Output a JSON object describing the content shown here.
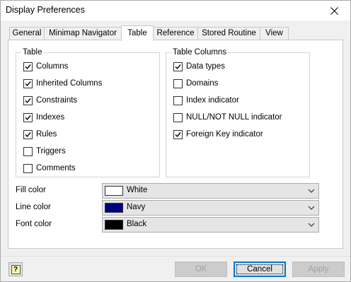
{
  "window": {
    "title": "Display Preferences"
  },
  "tabs": [
    {
      "label": "General",
      "active": false
    },
    {
      "label": "Minimap Navigator",
      "active": false
    },
    {
      "label": "Table",
      "active": true
    },
    {
      "label": "Reference",
      "active": false
    },
    {
      "label": "Stored Routine",
      "active": false
    },
    {
      "label": "View",
      "active": false
    }
  ],
  "table_group": {
    "legend": "Table",
    "items": [
      {
        "label": "Columns",
        "checked": true
      },
      {
        "label": "Inherited Columns",
        "checked": true
      },
      {
        "label": "Constraints",
        "checked": true
      },
      {
        "label": "Indexes",
        "checked": true
      },
      {
        "label": "Rules",
        "checked": true
      },
      {
        "label": "Triggers",
        "checked": false
      },
      {
        "label": "Comments",
        "checked": false
      }
    ]
  },
  "columns_group": {
    "legend": "Table Columns",
    "items": [
      {
        "label": "Data types",
        "checked": true
      },
      {
        "label": "Domains",
        "checked": false
      },
      {
        "label": "Index indicator",
        "checked": false
      },
      {
        "label": "NULL/NOT NULL indicator",
        "checked": false
      },
      {
        "label": "Foreign Key indicator",
        "checked": true
      }
    ]
  },
  "colors": {
    "fill": {
      "label": "Fill color",
      "value": "White",
      "swatch": "#ffffff"
    },
    "line": {
      "label": "Line color",
      "value": "Navy",
      "swatch": "#000080"
    },
    "font": {
      "label": "Font color",
      "value": "Black",
      "swatch": "#000000"
    }
  },
  "buttons": {
    "help": "?",
    "ok": "OK",
    "cancel": "Cancel",
    "apply": "Apply"
  }
}
